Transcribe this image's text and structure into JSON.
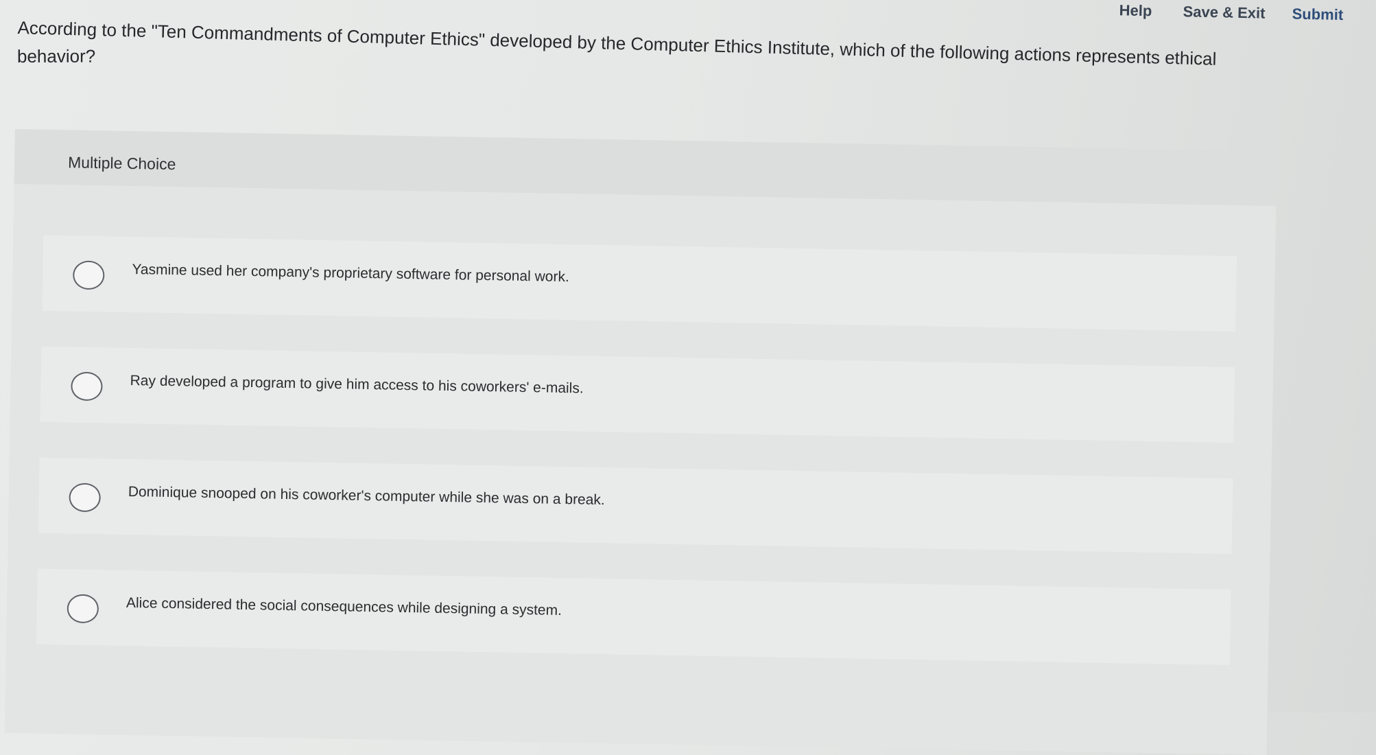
{
  "nav": {
    "help": "Help",
    "save_exit": "Save & Exit",
    "submit": "Submit"
  },
  "question": {
    "line1": "According to the \"Ten Commandments of Computer Ethics\" developed by the Computer Ethics Institute, which of the following actions represents ethical",
    "line2": "behavior?"
  },
  "multiple_choice": {
    "label": "Multiple Choice",
    "options": [
      {
        "text": "Yasmine used her company's proprietary software for personal work.",
        "selected": false
      },
      {
        "text": "Ray developed a program to give him access to his coworkers' e-mails.",
        "selected": false
      },
      {
        "text": "Dominique snooped on his coworker's computer while she was on a break.",
        "selected": false
      },
      {
        "text": "Alice considered the social consequences while designing a system.",
        "selected": false
      }
    ]
  }
}
